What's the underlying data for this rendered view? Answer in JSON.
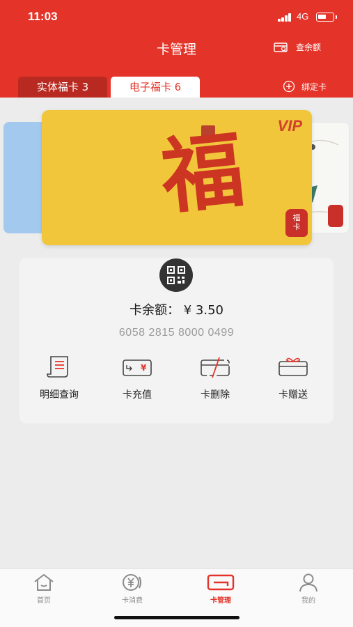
{
  "status_bar": {
    "time": "11:03",
    "network": "4G"
  },
  "header": {
    "title": "卡管理",
    "check_balance": "查余额"
  },
  "tabs": [
    {
      "label": "实体福卡 3",
      "active": false
    },
    {
      "label": "电子福卡 6",
      "active": true
    }
  ],
  "bind_card": "绑定卡",
  "card": {
    "vip_label": "VIP",
    "main_character": "福",
    "seal_text": [
      "福",
      "卡"
    ],
    "colors": {
      "card": "#f1c63a",
      "ink": "#cd3523"
    }
  },
  "panel": {
    "balance_text": "卡余额：  ¥  3.50",
    "card_number": "6058 2815 8000 0499",
    "actions": [
      {
        "label": "明细查询",
        "icon": "receipt-icon"
      },
      {
        "label": "卡充值",
        "icon": "card-recharge-icon"
      },
      {
        "label": "卡删除",
        "icon": "card-delete-icon"
      },
      {
        "label": "卡赠送",
        "icon": "card-gift-icon"
      }
    ]
  },
  "tabbar": [
    {
      "label": "首页",
      "icon": "home-icon",
      "active": false
    },
    {
      "label": "卡消费",
      "icon": "yen-coin-icon",
      "active": false
    },
    {
      "label": "卡管理",
      "icon": "card-icon",
      "active": true
    },
    {
      "label": "我的",
      "icon": "user-icon",
      "active": false
    }
  ],
  "colors": {
    "brand_red": "#e4342a",
    "active_tab_dark": "#b82a21"
  }
}
